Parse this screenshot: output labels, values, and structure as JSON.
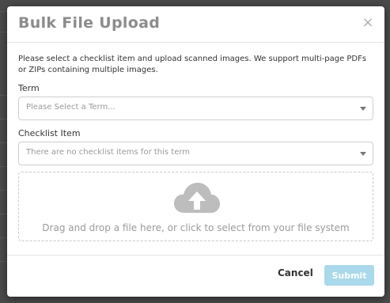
{
  "modal": {
    "title": "Bulk File Upload",
    "close_label": "×",
    "intro": "Please select a checklist item and upload scanned images. We support multi-page PDFs or ZIPs containing multiple images."
  },
  "term": {
    "label": "Term",
    "placeholder": "Please Select a Term..."
  },
  "checklist": {
    "label": "Checklist Item",
    "placeholder": "There are no checklist items for this term"
  },
  "dropzone": {
    "icon": "cloud-upload-icon",
    "text": "Drag and drop a file here, or click to select from your file system"
  },
  "footer": {
    "cancel_label": "Cancel",
    "submit_label": "Submit"
  },
  "colors": {
    "submit_bg": "#a9d9ea",
    "title": "#8c8c8c",
    "cloud": "#bdbdbd"
  }
}
